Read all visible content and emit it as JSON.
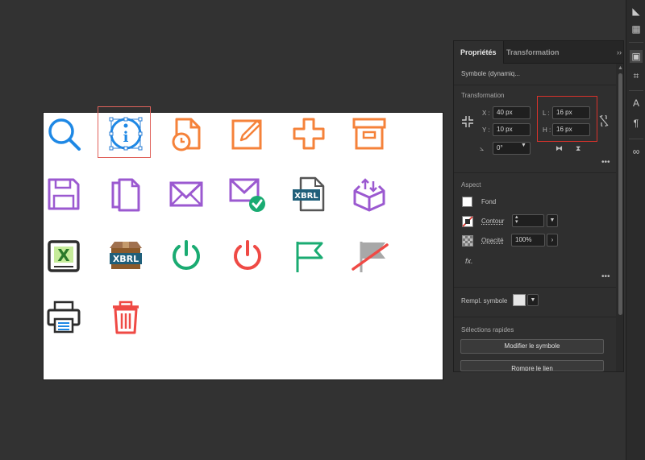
{
  "panel": {
    "tabs": [
      "Propriétés",
      "Transformation"
    ],
    "menu_glyph": "››",
    "object_name": "Symbole (dynamiq...",
    "transformation_title": "Transformation",
    "x_label": "X :",
    "x_value": "40 px",
    "y_label": "Y :",
    "y_value": "10 px",
    "w_label": "L :",
    "w_value": "16 px",
    "h_label": "H :",
    "h_value": "16 px",
    "angle_value": "0°",
    "more": "•••",
    "aspect_title": "Aspect",
    "fill_label": "Fond",
    "stroke_label": "Contour",
    "opacity_label": "Opacité",
    "opacity_value": "100%",
    "fx_label": "fx.",
    "symbol_fill_label": "Rempl. symbole",
    "quick_title": "Sélections rapides",
    "edit_symbol_button": "Modifier le symbole",
    "break_link_button": "Rompre le lien"
  },
  "colors": {
    "blue": "#1e88e5",
    "orange": "#f5823a",
    "purple": "#9b59d0",
    "green": "#1aab72",
    "red": "#ef4a45",
    "dark": "#2d2d2d",
    "xbrl_teal": "#1f5f7a",
    "selection_blue": "#2b7fd6",
    "highlight_red": "#d9322b"
  },
  "icons": [
    "search-icon",
    "info-icon",
    "document-clock-icon",
    "edit-icon",
    "plus-icon",
    "archive-icon",
    "save-icon",
    "copy-icon",
    "mail-icon",
    "mail-check-icon",
    "xbrl-file-icon",
    "box-upload-icon",
    "excel-icon",
    "xbrl-box-icon",
    "power-green-icon",
    "power-red-icon",
    "flag-icon",
    "flag-off-icon",
    "printer-icon",
    "trash-icon"
  ],
  "icon_text": {
    "info_letter": "i",
    "xbrl": "XBRL",
    "excel_letter": "X"
  }
}
